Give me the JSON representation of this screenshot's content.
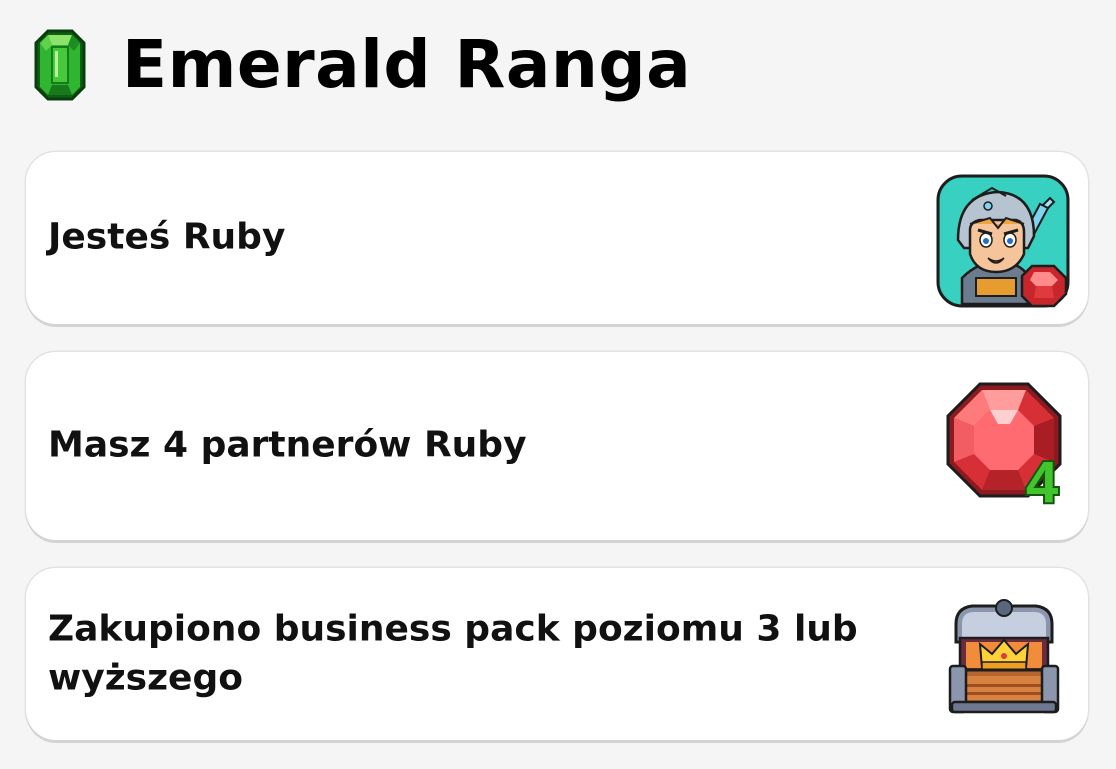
{
  "header": {
    "title": "Emerald Ranga",
    "icon": "emerald-gem-icon",
    "accent_color": "#2fb52f"
  },
  "requirements": [
    {
      "text": "Jesteś Ruby",
      "icon": "ruby-knight-avatar-icon"
    },
    {
      "text": "Masz 4 partnerów Ruby",
      "icon": "ruby-gem-4-icon",
      "badge": "4"
    },
    {
      "text": "Zakupiono business pack poziomu 3 lub wyższego",
      "icon": "treasure-chest-icon"
    }
  ],
  "colors": {
    "background": "#f5f5f5",
    "card": "#ffffff",
    "ruby": "#e0393e",
    "emerald": "#2fb52f"
  }
}
